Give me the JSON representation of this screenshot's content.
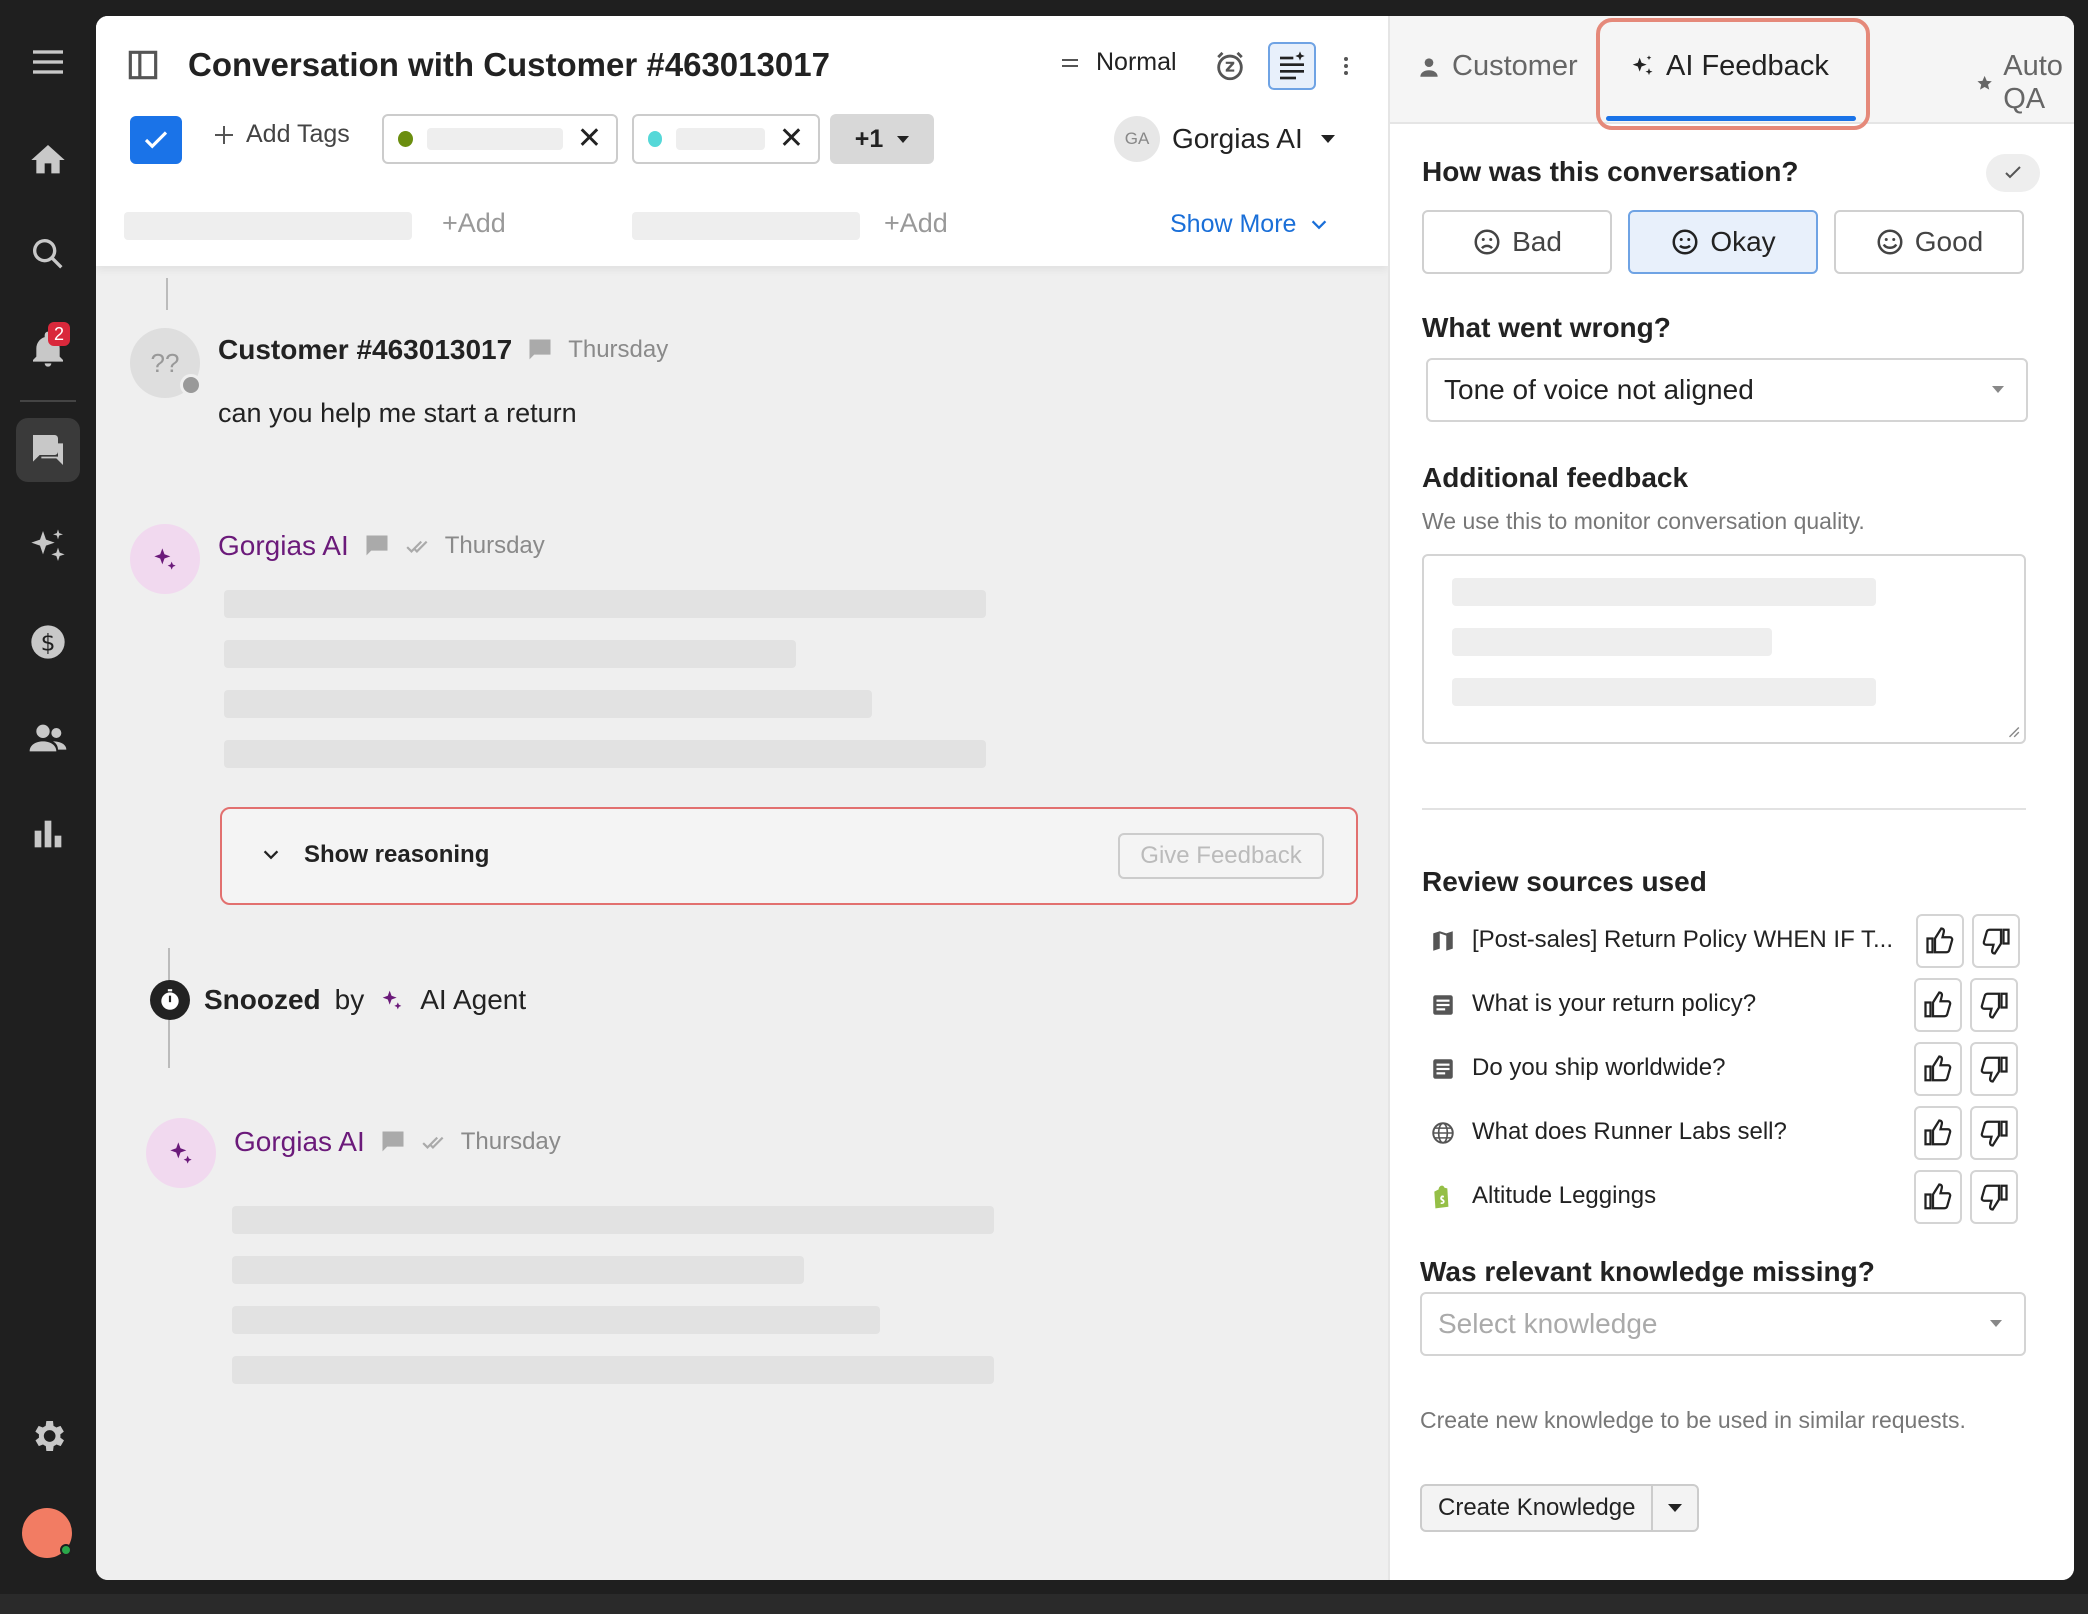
{
  "nav": {
    "items": [
      {
        "name": "menu-icon"
      },
      {
        "name": "home-icon"
      },
      {
        "name": "search-icon"
      },
      {
        "name": "bell-icon",
        "badge": "2"
      },
      {
        "name": "conversations-icon"
      },
      {
        "name": "sparkles-icon"
      },
      {
        "name": "dollar-icon"
      },
      {
        "name": "users-icon"
      },
      {
        "name": "bar-chart-icon"
      },
      {
        "name": "gear-icon"
      }
    ]
  },
  "header": {
    "title": "Conversation with Customer #463013017",
    "priority": "Normal",
    "add_tags": "Add Tags",
    "more_tags": "+1",
    "assignee_initials": "GA",
    "assignee": "Gorgias AI",
    "field_add_1": "+Add",
    "field_add_2": "+Add",
    "show_more": "Show More",
    "tag_colors": [
      "#6b8e0f",
      "#55d8d8"
    ]
  },
  "conversation": {
    "customer_avatar": "??",
    "customer_name": "Customer #463013017",
    "customer_time": "Thursday",
    "customer_message": "can you help me start a return",
    "ai_name_1": "Gorgias AI",
    "ai_time_1": "Thursday",
    "show_reasoning": "Show reasoning",
    "give_feedback": "Give Feedback",
    "snoozed_prefix": "Snoozed",
    "snoozed_by": "by",
    "snoozed_agent": "AI Agent",
    "ai_name_2": "Gorgias AI",
    "ai_time_2": "Thursday"
  },
  "panel": {
    "tabs": [
      {
        "label": "Customer"
      },
      {
        "label": "AI Feedback"
      },
      {
        "label": "Auto QA"
      }
    ],
    "rating_question": "How was this conversation?",
    "ratings": [
      {
        "label": "Bad"
      },
      {
        "label": "Okay",
        "selected": true
      },
      {
        "label": "Good"
      }
    ],
    "wrong_question": "What went wrong?",
    "wrong_value": "Tone of voice not aligned",
    "additional_title": "Additional feedback",
    "additional_sub": "We use this to monitor conversation quality.",
    "sources_title": "Review sources used",
    "sources": [
      {
        "icon": "map-icon",
        "label": "[Post-sales] Return Policy WHEN IF T..."
      },
      {
        "icon": "article-icon",
        "label": "What is your return policy?"
      },
      {
        "icon": "article-icon",
        "label": "Do you ship worldwide?"
      },
      {
        "icon": "globe-icon",
        "label": "What does Runner Labs sell?"
      },
      {
        "icon": "shopify-icon",
        "label": "Altitude Leggings"
      }
    ],
    "missing_title": "Was relevant knowledge missing?",
    "missing_placeholder": "Select knowledge",
    "create_note": "Create new knowledge to be used in similar requests.",
    "create_button": "Create Knowledge",
    "accent_color": "#1a73e8",
    "highlight_color": "#e5897a"
  }
}
